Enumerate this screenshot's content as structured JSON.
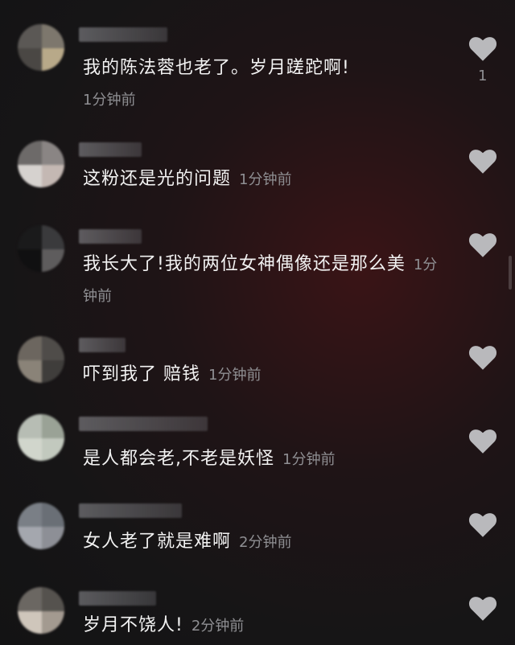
{
  "comments": [
    {
      "text": "我的陈法蓉也老了。岁月蹉跎啊!",
      "time": "1分钟前",
      "likes": "1"
    },
    {
      "text": "这粉还是光的问题",
      "time": "1分钟前"
    },
    {
      "text": "我长大了!我的两位女神偶像还是那么美",
      "time": "1分钟前"
    },
    {
      "text": "吓到我了 赔钱",
      "time": "1分钟前"
    },
    {
      "text": "是人都会老,不老是妖怪",
      "time": "1分钟前"
    },
    {
      "text": "女人老了就是难啊",
      "time": "2分钟前"
    },
    {
      "text": "岁月不饶人!",
      "time": "2分钟前"
    }
  ],
  "colors": {
    "heart": "#b9b9bc",
    "time_text": "#8f8f93"
  },
  "icons": {
    "like": "heart-icon"
  }
}
